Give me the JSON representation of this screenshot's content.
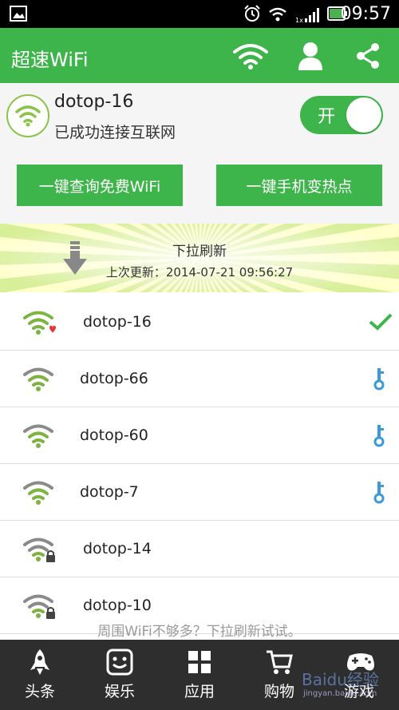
{
  "status_bar": {
    "time": "09:57"
  },
  "app_bar": {
    "title": "超速WiFi",
    "icons": [
      "wifi-icon",
      "user-icon",
      "share-icon"
    ]
  },
  "connected": {
    "ssid": "dotop-16",
    "status": "已成功连接互联网",
    "toggle_label": "开"
  },
  "actions": {
    "query_free_wifi": "一键查询免费WiFi",
    "hotspot": "一键手机变热点"
  },
  "pull_refresh": {
    "title": "下拉刷新",
    "last_update": "上次更新：2014-07-21 09:56:27"
  },
  "networks": [
    {
      "ssid": "dotop-16",
      "badge": "heart",
      "trailing": "check"
    },
    {
      "ssid": "dotop-66",
      "badge": "",
      "trailing": "key"
    },
    {
      "ssid": "dotop-60",
      "badge": "",
      "trailing": "key"
    },
    {
      "ssid": "dotop-7",
      "badge": "",
      "trailing": "key"
    },
    {
      "ssid": "dotop-14",
      "badge": "lock",
      "trailing": ""
    },
    {
      "ssid": "dotop-10",
      "badge": "lock",
      "trailing": ""
    }
  ],
  "hint": "周围WiFi不够多？下拉刷新试试。",
  "tabs": [
    {
      "label": "头条",
      "icon": "rocket-icon"
    },
    {
      "label": "娱乐",
      "icon": "smiley-icon"
    },
    {
      "label": "应用",
      "icon": "grid-icon"
    },
    {
      "label": "购物",
      "icon": "cart-icon"
    },
    {
      "label": "游戏",
      "icon": "gamepad-icon"
    }
  ],
  "watermark": {
    "text": "Baidu经验",
    "url": "jingyan.baidu.com"
  },
  "colors": {
    "accent": "#3eb54a",
    "tabbar": "#2e2e2e",
    "key": "#3a9ad9",
    "heart": "#e53935"
  }
}
